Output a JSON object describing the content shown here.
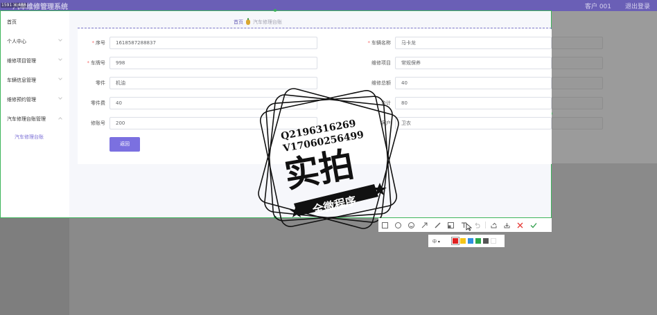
{
  "header": {
    "app_title": "汽车维修管理系统",
    "size_tag": "1591 × 488",
    "user": "客户 001",
    "logout": "退出登录"
  },
  "sidebar": {
    "items": [
      {
        "label": "首页",
        "chevron": false
      },
      {
        "label": "个人中心",
        "chevron": "down"
      },
      {
        "label": "维修项目管理",
        "chevron": "down"
      },
      {
        "label": "车辆信息管理",
        "chevron": "down"
      },
      {
        "label": "维修预约管理",
        "chevron": "down"
      },
      {
        "label": "汽车修理台账管理",
        "chevron": "up"
      }
    ],
    "subitem": "汽车修理台账"
  },
  "breadcrumb": {
    "home": "首页",
    "current": "汽车修理台账"
  },
  "form": {
    "fields": [
      {
        "label": "序号",
        "required": true,
        "value": "1618587288837"
      },
      {
        "label": "车辆名称",
        "required": true,
        "value": "马卡龙"
      },
      {
        "label": "车牌号",
        "required": true,
        "value": "998"
      },
      {
        "label": "维修项目",
        "required": false,
        "value": "常规保养"
      },
      {
        "label": "零件",
        "required": false,
        "value": "机油"
      },
      {
        "label": "维修总额",
        "required": false,
        "value": "40"
      },
      {
        "label": "零件费",
        "required": false,
        "value": "40"
      },
      {
        "label": "合计",
        "required": false,
        "value": "80"
      },
      {
        "label": "修账号",
        "required": false,
        "value": "200"
      },
      {
        "label": "客户",
        "required": false,
        "value": "卫衣"
      }
    ],
    "back_label": "返回"
  },
  "stamp": {
    "line1": "Q2196316269",
    "line2": "V17060256499",
    "main": "实拍",
    "banner": "全微程序"
  },
  "toolbar": {
    "tools": [
      "rect-icon",
      "circle-icon",
      "emoji-icon",
      "arrow-icon",
      "pen-icon",
      "mosaic-icon",
      "text-icon",
      "undo-icon",
      "share-icon",
      "download-icon",
      "cancel-icon",
      "confirm-icon"
    ],
    "size_option": "中",
    "colors": [
      "#e02020",
      "#f5c518",
      "#2f8ee0",
      "#2aa84a",
      "#555555",
      "#ffffff"
    ]
  }
}
